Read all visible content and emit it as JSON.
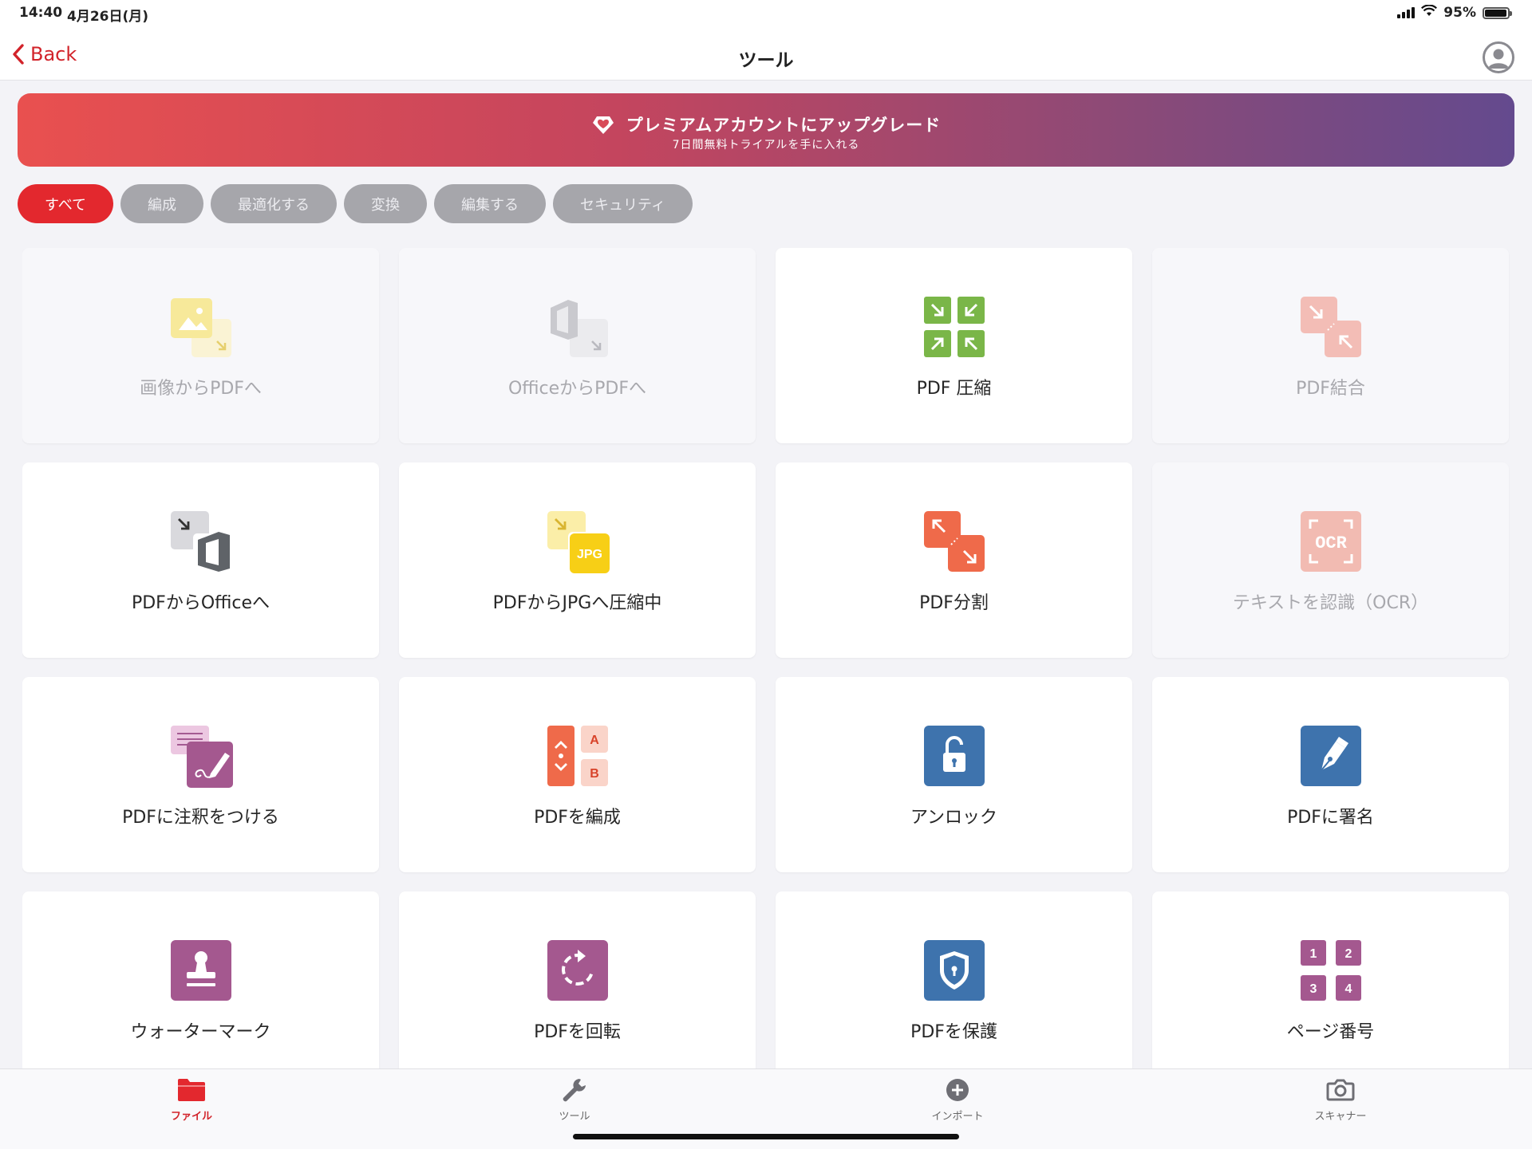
{
  "status": {
    "time": "14:40",
    "date": "4月26日(月)",
    "battery": "95%",
    "battery_level": 0.95
  },
  "nav": {
    "back": "Back",
    "title": "ツール",
    "avatar_icon": "user-circle-icon"
  },
  "banner": {
    "icon": "diamond-heart-icon",
    "title": "プレミアムアカウントにアップグレード",
    "subtitle": "7日間無料トライアルを手に入れる"
  },
  "filters": [
    {
      "label": "すべて",
      "active": true
    },
    {
      "label": "編成",
      "active": false
    },
    {
      "label": "最適化する",
      "active": false
    },
    {
      "label": "変換",
      "active": false
    },
    {
      "label": "編集する",
      "active": false
    },
    {
      "label": "セキュリティ",
      "active": false
    }
  ],
  "tools": [
    {
      "label": "画像からPDFへ",
      "icon": "image-to-pdf-icon",
      "enabled": false
    },
    {
      "label": "OfficeからPDFへ",
      "icon": "office-to-pdf-icon",
      "enabled": false
    },
    {
      "label": "PDF 圧縮",
      "icon": "compress-icon",
      "enabled": true
    },
    {
      "label": "PDF結合",
      "icon": "merge-icon",
      "enabled": false
    },
    {
      "label": "PDFからOfficeへ",
      "icon": "pdf-to-office-icon",
      "enabled": true
    },
    {
      "label": "PDFからJPGへ圧縮中",
      "icon": "pdf-to-jpg-icon",
      "icon_text": "JPG",
      "enabled": true
    },
    {
      "label": "PDF分割",
      "icon": "split-icon",
      "enabled": true
    },
    {
      "label": "テキストを認識（OCR）",
      "icon": "ocr-icon",
      "icon_text": "OCR",
      "enabled": false
    },
    {
      "label": "PDFに注釈をつける",
      "icon": "annotate-icon",
      "enabled": true
    },
    {
      "label": "PDFを編成",
      "icon": "organize-icon",
      "icon_text": [
        "A",
        "B"
      ],
      "enabled": true
    },
    {
      "label": "アンロック",
      "icon": "unlock-icon",
      "enabled": true
    },
    {
      "label": "PDFに署名",
      "icon": "sign-pen-icon",
      "enabled": true
    },
    {
      "label": "ウォーターマーク",
      "icon": "stamp-icon",
      "enabled": true
    },
    {
      "label": "PDFを回転",
      "icon": "rotate-icon",
      "enabled": true
    },
    {
      "label": "PDFを保護",
      "icon": "shield-lock-icon",
      "enabled": true
    },
    {
      "label": "ページ番号",
      "icon": "page-number-icon",
      "icon_text": [
        "1",
        "2",
        "3",
        "4"
      ],
      "enabled": true
    }
  ],
  "tabs": [
    {
      "label": "ファイル",
      "icon": "folder-icon",
      "active": true
    },
    {
      "label": "ツール",
      "icon": "wrench-icon",
      "active": false
    },
    {
      "label": "インポート",
      "icon": "plus-circle-icon",
      "active": false
    },
    {
      "label": "スキャナー",
      "icon": "camera-icon",
      "active": false
    }
  ]
}
